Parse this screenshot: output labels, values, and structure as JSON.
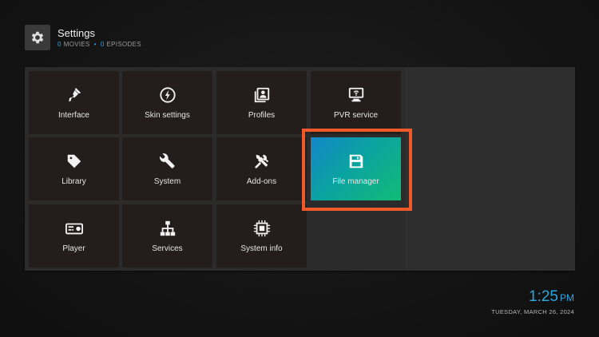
{
  "header": {
    "title": "Settings",
    "movies_count": "0",
    "movies_label": "MOVIES",
    "separator": "•",
    "episodes_count": "0",
    "episodes_label": "EPISODES",
    "icon": "gear-icon"
  },
  "tiles": [
    {
      "label": "Interface",
      "icon": "paintbrush-icon"
    },
    {
      "label": "Skin settings",
      "icon": "skin-icon"
    },
    {
      "label": "Profiles",
      "icon": "profiles-icon"
    },
    {
      "label": "PVR service",
      "icon": "pvr-icon"
    },
    {
      "label": "Library",
      "icon": "tag-icon"
    },
    {
      "label": "System",
      "icon": "wrench-icon"
    },
    {
      "label": "Add-ons",
      "icon": "tools-icon"
    },
    {
      "label": "File manager",
      "icon": "floppy-icon",
      "focused": true
    },
    {
      "label": "Player",
      "icon": "player-icon"
    },
    {
      "label": "Services",
      "icon": "network-icon"
    },
    {
      "label": "System info",
      "icon": "cpu-icon"
    }
  ],
  "clock": {
    "time": "1:25",
    "ampm": "PM",
    "date": "TUESDAY, MARCH 26, 2024"
  },
  "colors": {
    "accent": "#2ea6e0",
    "highlight_border": "#f05a2a",
    "focus_gradient_start": "#1486c9",
    "focus_gradient_end": "#12bb76"
  }
}
